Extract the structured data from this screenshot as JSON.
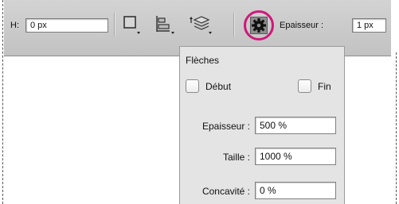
{
  "toolbar": {
    "height_label": "H:",
    "height_value": "0 px",
    "thickness_label": "Epaisseur :",
    "thickness_value": "1 px",
    "icons": [
      "stroke-square-icon",
      "align-icon",
      "arrange-layers-icon",
      "gear-icon"
    ]
  },
  "panel": {
    "title": "Flèches",
    "start_label": "Début",
    "end_label": "Fin",
    "fields": [
      {
        "label": "Epaisseur :",
        "value": "500 %"
      },
      {
        "label": "Taille :",
        "value": "1000 %"
      },
      {
        "label": "Concavité :",
        "value": "0 %"
      }
    ]
  },
  "colors": {
    "highlight_ring": "#d0177a",
    "toolbar_bg": "#c9c9c9",
    "panel_bg": "#e4e4e4"
  }
}
